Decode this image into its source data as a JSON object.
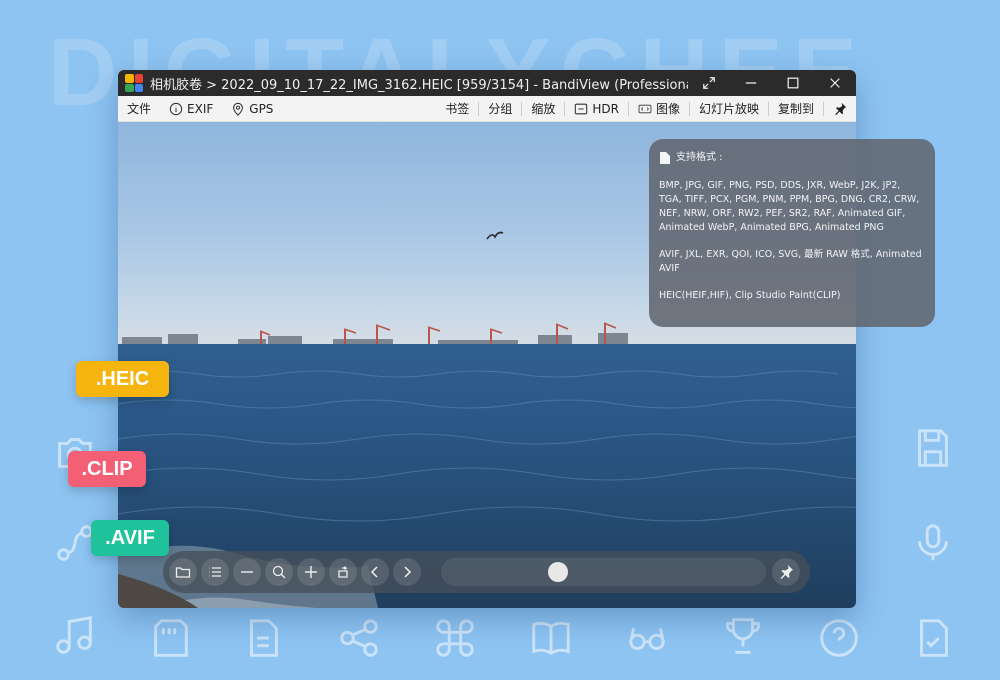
{
  "background": {
    "watermark": "DIGITALYCHEE",
    "color": "#8ec4f2"
  },
  "window": {
    "title": "相机胶卷 > 2022_09_10_17_22_IMG_3162.HEIC [959/3154] - BandiView (Professional)",
    "controls": [
      "fullscreen-icon",
      "minimize-icon",
      "maximize-icon",
      "close-icon"
    ]
  },
  "menubar": {
    "file": "文件",
    "exif": "EXIF",
    "gps": "GPS",
    "bookmark": "书签",
    "group": "分组",
    "zoom": "缩放",
    "hdr": "HDR",
    "image": "图像",
    "slideshow": "幻灯片放映",
    "copy_to": "复制到"
  },
  "format_panel": {
    "heading": "支持格式 :",
    "list1": "BMP, JPG, GIF, PNG, PSD, DDS, JXR, WebP, J2K, JP2, TGA, TIFF, PCX, PGM, PNM, PPM, BPG, DNG, CR2, CRW, NEF, NRW, ORF, RW2, PEF, SR2, RAF, Animated GIF, Animated WebP, Animated BPG, Animated PNG",
    "list2": "AVIF, JXL, EXR, QOI, ICO, SVG, 最新 RAW 格式, Animated AVIF",
    "list3": "HEIC(HEIF,HIF), Clip Studio Paint(CLIP)"
  },
  "badges": {
    "heic": ".HEIC",
    "clip": ".CLIP",
    "avif": ".AVIF",
    "heic_color": "#f6b40f",
    "clip_color": "#f35f74",
    "avif_color": "#1fc29a"
  },
  "controlbar": {
    "buttons": [
      "folder-icon",
      "list-icon",
      "zoom-out-icon",
      "zoom-fit-icon",
      "zoom-in-icon",
      "rotate-icon",
      "previous-icon",
      "next-icon",
      "pin-icon"
    ],
    "seek_position": 0.35
  }
}
